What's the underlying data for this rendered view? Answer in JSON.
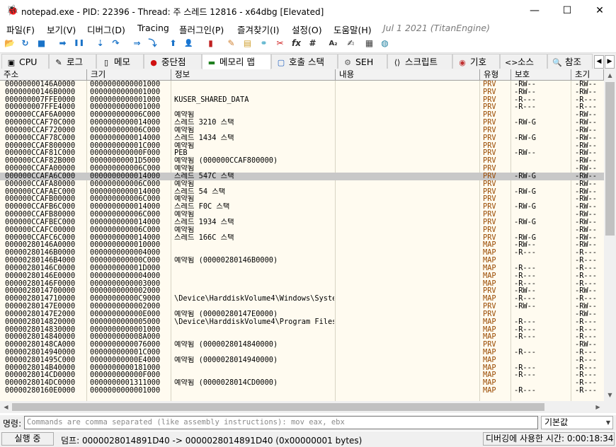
{
  "window": {
    "title": "notepad.exe - PID: 22396 - Thread: 주 스레드 12816 - x64dbg [Elevated]",
    "icon": "bug-icon",
    "minimize_glyph": "—",
    "maximize_glyph": "☐",
    "close_glyph": "✕"
  },
  "menu": {
    "items": [
      "파일(F)",
      "보기(V)",
      "디버그(D)",
      "Tracing",
      "플러그인(P)",
      "즐겨찾기(I)",
      "설정(O)",
      "도움말(H)"
    ],
    "version": "Jul 1 2021 (TitanEngine)"
  },
  "toolbar": {
    "buttons": [
      {
        "icon": "open-folder-icon",
        "glyph": "📂"
      },
      {
        "icon": "restart-icon",
        "glyph": "↻"
      },
      {
        "icon": "stop-icon",
        "glyph": "■"
      },
      {
        "icon": "run-icon",
        "glyph": "➡"
      },
      {
        "icon": "pause-icon",
        "glyph": "❚❚"
      },
      {
        "icon": "step-into-icon",
        "glyph": "⇣"
      },
      {
        "icon": "step-over-icon",
        "glyph": "↷"
      },
      {
        "icon": "trace-into-icon",
        "glyph": "⇒"
      },
      {
        "icon": "trace-over-icon",
        "glyph": "⤵"
      },
      {
        "icon": "execute-till-return-icon",
        "glyph": "⬆"
      },
      {
        "icon": "run-to-user-code-icon",
        "glyph": "👤"
      },
      {
        "icon": "scylla-icon",
        "glyph": "▮"
      },
      {
        "icon": "comment-icon",
        "glyph": "✎"
      },
      {
        "icon": "label-icon",
        "glyph": "▤"
      },
      {
        "icon": "bookmark-icon",
        "glyph": "⚭"
      },
      {
        "icon": "function-icon",
        "glyph": "✂"
      },
      {
        "icon": "fx-icon",
        "glyph": "fx"
      },
      {
        "icon": "hash-icon",
        "glyph": "#"
      },
      {
        "icon": "font-size-icon",
        "glyph": "A₂"
      },
      {
        "icon": "strings-icon",
        "glyph": "✍"
      },
      {
        "icon": "calculator-icon",
        "glyph": "▦"
      },
      {
        "icon": "globe-icon",
        "glyph": "◍"
      }
    ]
  },
  "tabs": [
    {
      "label": "CPU",
      "icon": "cpu-icon",
      "glyph": "▣",
      "active": false
    },
    {
      "label": "로그",
      "icon": "log-icon",
      "glyph": "✎",
      "active": false
    },
    {
      "label": "메모",
      "icon": "notes-icon",
      "glyph": "▯",
      "active": false
    },
    {
      "label": "중단점",
      "icon": "breakpoint-icon",
      "glyph": "●",
      "active": false
    },
    {
      "label": "메모리 맵",
      "icon": "memory-map-icon",
      "glyph": "▬",
      "active": true
    },
    {
      "label": "호출 스택",
      "icon": "call-stack-icon",
      "glyph": "▢",
      "active": false
    },
    {
      "label": "SEH",
      "icon": "seh-icon",
      "glyph": "⚙",
      "active": false
    },
    {
      "label": "스크립트",
      "icon": "script-icon",
      "glyph": "⟨⟩",
      "active": false
    },
    {
      "label": "기호",
      "icon": "symbols-icon",
      "glyph": "◉",
      "active": false
    },
    {
      "label": "소스",
      "icon": "source-icon",
      "glyph": "<>",
      "active": false
    },
    {
      "label": "참조",
      "icon": "references-icon",
      "glyph": "🔍",
      "active": false
    }
  ],
  "table": {
    "columns": [
      "주소",
      "크기",
      "정보",
      "내용",
      "유형",
      "보호",
      "초기"
    ],
    "selected_index": 12,
    "rows": [
      [
        "00000000146A0000",
        "0000000000001000",
        "",
        "",
        "PRV",
        "-RW--",
        "-RW--"
      ],
      [
        "00000000146B0000",
        "0000000000001000",
        "",
        "",
        "PRV",
        "-RW--",
        "-RW--"
      ],
      [
        "000000007FFE0000",
        "0000000000001000",
        "KUSER_SHARED_DATA",
        "",
        "PRV",
        "-R---",
        "-R---"
      ],
      [
        "000000007FFE4000",
        "0000000000001000",
        "",
        "",
        "PRV",
        "-R---",
        "-R---"
      ],
      [
        "000000CCAF6A0000",
        "000000000006C000",
        "예약됨",
        "",
        "PRV",
        "",
        "-RW--"
      ],
      [
        "000000CCAF70C000",
        "0000000000014000",
        "스레드 3210 스택",
        "",
        "PRV",
        "-RW-G",
        "-RW--"
      ],
      [
        "000000CCAF720000",
        "000000000006C000",
        "예약됨",
        "",
        "PRV",
        "",
        "-RW--"
      ],
      [
        "000000CCAF78C000",
        "0000000000014000",
        "스레드 1434 스택",
        "",
        "PRV",
        "-RW-G",
        "-RW--"
      ],
      [
        "000000CCAF800000",
        "000000000001C000",
        "예약됨",
        "",
        "PRV",
        "",
        "-RW--"
      ],
      [
        "000000CCAF81C000",
        "000000000000F000",
        "PEB",
        "",
        "PRV",
        "-RW--",
        "-RW--"
      ],
      [
        "000000CCAF82B000",
        "00000000001D5000",
        "예약됨 (000000CCAF800000)",
        "",
        "PRV",
        "",
        "-RW--"
      ],
      [
        "000000CCAFA00000",
        "000000000006C000",
        "예약됨",
        "",
        "PRV",
        "",
        "-RW--"
      ],
      [
        "000000CCAFA6C000",
        "0000000000014000",
        "스레드 547C 스택",
        "",
        "PRV",
        "-RW-G",
        "-RW--"
      ],
      [
        "000000CCAFA80000",
        "000000000006C000",
        "예약됨",
        "",
        "PRV",
        "",
        "-RW--"
      ],
      [
        "000000CCAFAEC000",
        "0000000000014000",
        "스레드 54 스택",
        "",
        "PRV",
        "-RW-G",
        "-RW--"
      ],
      [
        "000000CCAFB00000",
        "000000000006C000",
        "예약됨",
        "",
        "PRV",
        "",
        "-RW--"
      ],
      [
        "000000CCAFB6C000",
        "0000000000014000",
        "스레드 F0C 스택",
        "",
        "PRV",
        "-RW-G",
        "-RW--"
      ],
      [
        "000000CCAFB80000",
        "000000000006C000",
        "예약됨",
        "",
        "PRV",
        "",
        "-RW--"
      ],
      [
        "000000CCAFBEC000",
        "0000000000014000",
        "스레드 1934 스택",
        "",
        "PRV",
        "-RW-G",
        "-RW--"
      ],
      [
        "000000CCAFC00000",
        "000000000006C000",
        "예약됨",
        "",
        "PRV",
        "",
        "-RW--"
      ],
      [
        "000000CCAFC6C000",
        "0000000000014000",
        "스레드 166C 스택",
        "",
        "PRV",
        "-RW-G",
        "-RW--"
      ],
      [
        "00000280146A0000",
        "0000000000010000",
        "",
        "",
        "MAP",
        "-RW--",
        "-RW--"
      ],
      [
        "00000280146B0000",
        "0000000000004000",
        "",
        "",
        "MAP",
        "-R---",
        "-R---"
      ],
      [
        "00000280146B4000",
        "000000000000C000",
        "예약됨 (00000280146B0000)",
        "",
        "MAP",
        "",
        "-R---"
      ],
      [
        "00000280146C0000",
        "000000000001D000",
        "",
        "",
        "MAP",
        "-R---",
        "-R---"
      ],
      [
        "00000280146E0000",
        "0000000000004000",
        "",
        "",
        "MAP",
        "-R---",
        "-R---"
      ],
      [
        "00000280146F0000",
        "0000000000003000",
        "",
        "",
        "MAP",
        "-R---",
        "-R---"
      ],
      [
        "0000028014700000",
        "0000000000002000",
        "",
        "",
        "PRV",
        "-RW--",
        "-RW--"
      ],
      [
        "0000028014710000",
        "00000000000C9000",
        "\\Device\\HarddiskVolume4\\Windows\\System32\\locale.nls",
        "",
        "MAP",
        "-R---",
        "-R---"
      ],
      [
        "00000280147E0000",
        "0000000000002000",
        "",
        "",
        "PRV",
        "-RW--",
        "-RW--"
      ],
      [
        "00000280147E2000",
        "000000000000E000",
        "예약됨 (00000280147E0000)",
        "",
        "PRV",
        "",
        "-RW--"
      ],
      [
        "0000028014820000",
        "0000000000005000",
        "\\Device\\HarddiskVolume4\\Program Files\\WindowsApps",
        "",
        "MAP",
        "-R---",
        "-R---"
      ],
      [
        "0000028014830000",
        "0000000000001000",
        "",
        "",
        "MAP",
        "-R---",
        "-R---"
      ],
      [
        "0000028014840000",
        "000000000008A000",
        "",
        "",
        "MAP",
        "-R---",
        "-R---"
      ],
      [
        "00000280148CA000",
        "0000000000076000",
        "예약됨 (0000028014840000)",
        "",
        "PRV",
        "",
        "-RW--"
      ],
      [
        "0000028014940000",
        "000000000001C000",
        "",
        "",
        "MAP",
        "-R---",
        "-R---"
      ],
      [
        "000002801495C000",
        "00000000000E4000",
        "예약됨 (0000028014940000)",
        "",
        "MAP",
        "",
        "-R---"
      ],
      [
        "0000028014B40000",
        "0000000000181000",
        "",
        "",
        "MAP",
        "-R---",
        "-R---"
      ],
      [
        "0000028014CD0000",
        "000000000000F000",
        "",
        "",
        "MAP",
        "-R---",
        "-R---"
      ],
      [
        "0000028014DC0000",
        "0000000001311000",
        "예약됨 (0000028014CD0000)",
        "",
        "MAP",
        "",
        "-R---"
      ],
      [
        "00000280160E0000",
        "0000000000001000",
        "",
        "",
        "MAP",
        "-R---",
        "-R---"
      ]
    ]
  },
  "command": {
    "label": "명령:",
    "placeholder": "Commands are comma separated (like assembly instructions): mov eax, ebx",
    "mode": "기본값"
  },
  "status": {
    "state": "실행 중",
    "message": "덤프: 0000028014891D40 -> 0000028014891D40 (0x00000001 bytes)",
    "time": "디버깅에 사용한 시간: 0:00:18:34"
  }
}
